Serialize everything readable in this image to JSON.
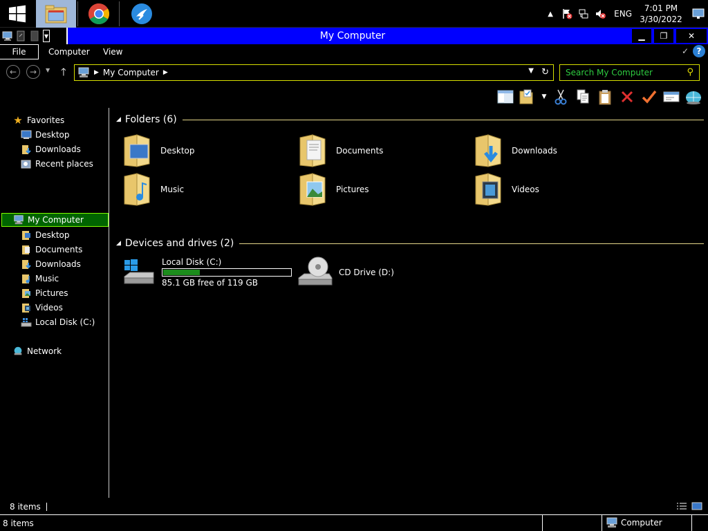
{
  "taskbar": {
    "apps": [
      {
        "name": "file-explorer",
        "active": true
      },
      {
        "name": "chrome",
        "active": false
      },
      {
        "name": "app-3",
        "active": false
      }
    ],
    "tray": {
      "language": "ENG",
      "time": "7:01 PM",
      "date": "3/30/2022"
    }
  },
  "window": {
    "title": "My Computer",
    "buttons": {
      "minimize": "▁",
      "maximize": "❐",
      "close": "✕"
    }
  },
  "ribbon": {
    "tabs": [
      {
        "label": "File"
      },
      {
        "label": "Computer"
      },
      {
        "label": "View"
      }
    ]
  },
  "address": {
    "path": "My Computer",
    "search_placeholder": "Search My Computer"
  },
  "nav": {
    "favorites_label": "Favorites",
    "favorites": [
      {
        "label": "Desktop"
      },
      {
        "label": "Downloads"
      },
      {
        "label": "Recent places"
      }
    ],
    "computer_label": "My Computer",
    "computer_items": [
      {
        "label": "Desktop"
      },
      {
        "label": "Documents"
      },
      {
        "label": "Downloads"
      },
      {
        "label": "Music"
      },
      {
        "label": "Pictures"
      },
      {
        "label": "Videos"
      },
      {
        "label": "Local Disk (C:)"
      }
    ],
    "network_label": "Network"
  },
  "content": {
    "folders_heading": "Folders (6)",
    "folders": [
      {
        "label": "Desktop"
      },
      {
        "label": "Documents"
      },
      {
        "label": "Downloads"
      },
      {
        "label": "Music"
      },
      {
        "label": "Pictures"
      },
      {
        "label": "Videos"
      }
    ],
    "devices_heading": "Devices and drives (2)",
    "drives": [
      {
        "label": "Local Disk (C:)",
        "free": "85.1 GB free of 119 GB",
        "used_fraction": 0.285
      },
      {
        "label": "CD Drive (D:)"
      }
    ]
  },
  "status": {
    "count": "8 items"
  },
  "bottom": {
    "count": "8 items",
    "computer": "Computer"
  },
  "colors": {
    "title_bar": "#0000ff",
    "accent_border": "#d8e000",
    "search_text": "#2ecc40",
    "selected_bg": "#006400",
    "drive_fill": "#1c8c1c"
  }
}
